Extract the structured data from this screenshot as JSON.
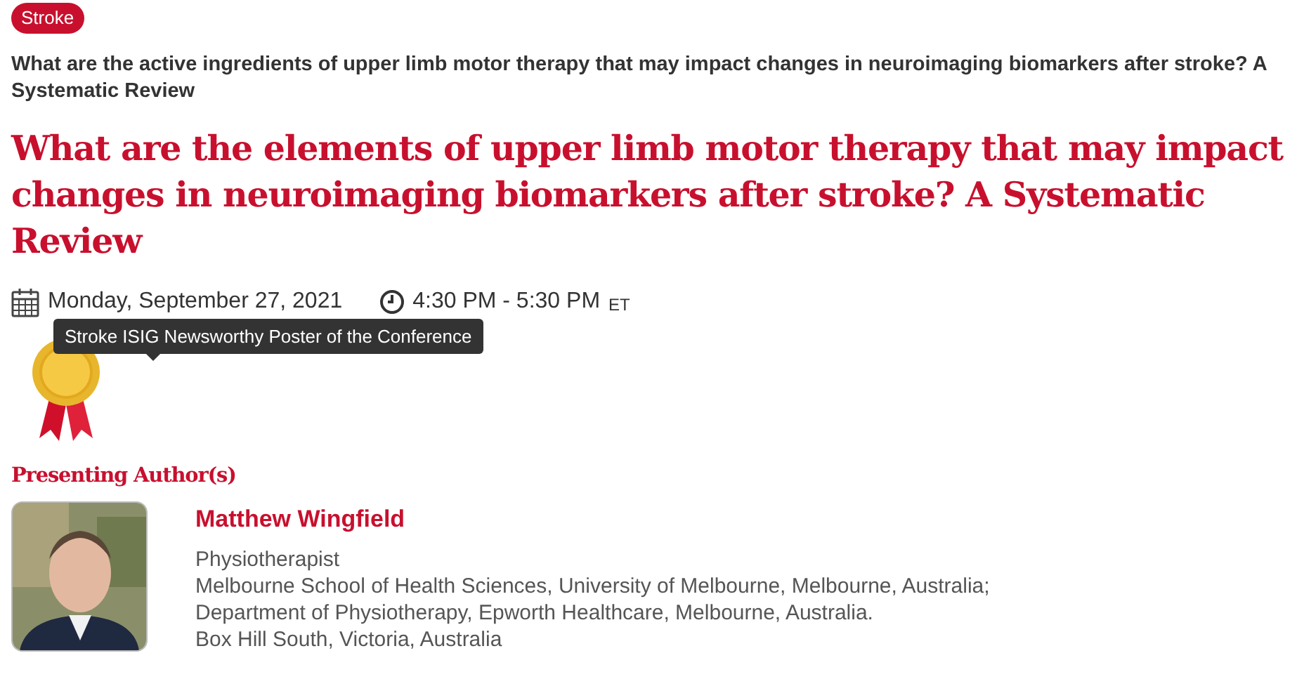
{
  "tag": "Stroke",
  "subtitle": "What are the active ingredients of upper limb motor therapy that may impact changes in neuroimaging biomarkers after stroke? A Systematic Review",
  "title": "What are the elements of upper limb motor therapy that may impact changes in neuroimaging biomarkers after stroke? A Systematic Review",
  "schedule": {
    "date": "Monday, September 27, 2021",
    "time": "4:30 PM - 5:30 PM",
    "timezone": "ET"
  },
  "award": {
    "tooltip": "Stroke ISIG Newsworthy Poster of the Conference"
  },
  "authors_heading": "Presenting Author(s)",
  "authors": [
    {
      "name": "Matthew Wingfield",
      "details": [
        "Physiotherapist",
        "Melbourne School of Health Sciences, University of Melbourne, Melbourne, Australia;",
        "Department of Physiotherapy, Epworth Healthcare, Melbourne, Australia.",
        "Box Hill South, Victoria, Australia"
      ]
    }
  ]
}
